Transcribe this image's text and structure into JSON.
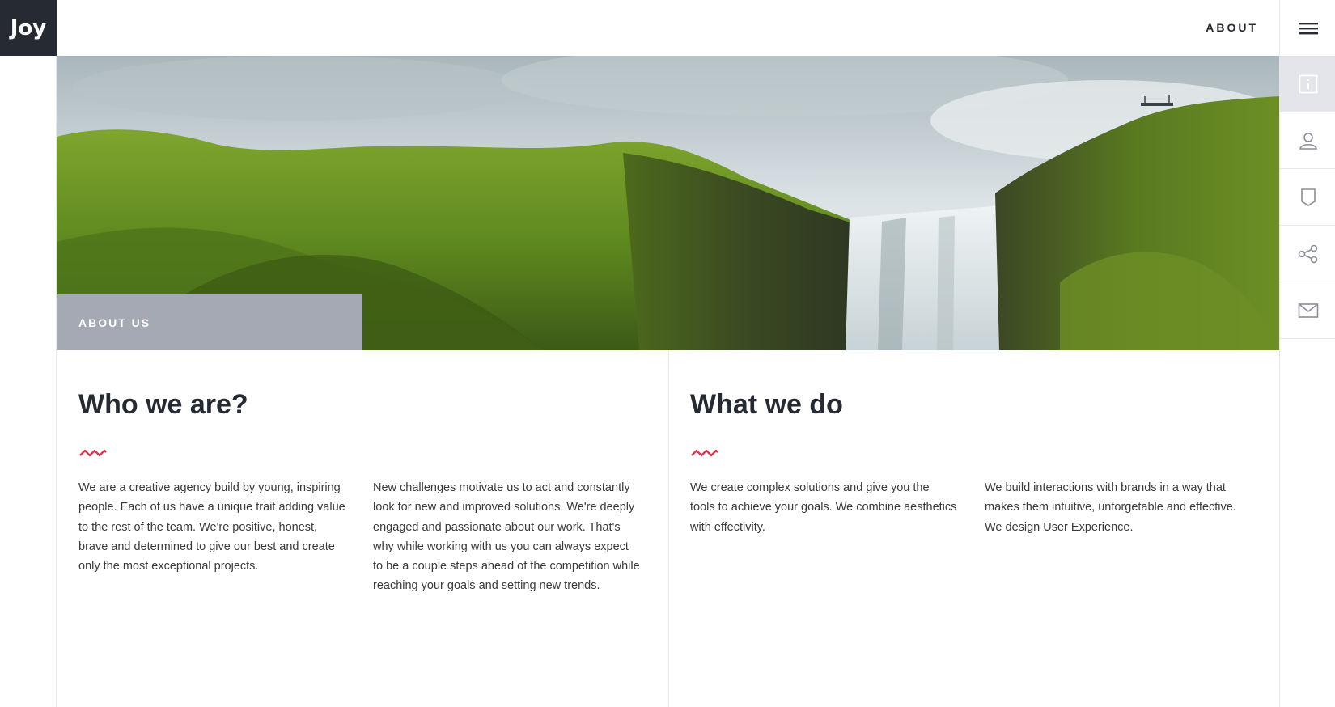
{
  "brand": {
    "logo_text": "Joy"
  },
  "header": {
    "nav_label": "ABOUT"
  },
  "sidebar": {
    "icons": [
      "info-icon",
      "user-icon",
      "bookmark-icon",
      "share-icon",
      "mail-icon"
    ],
    "active_index": 0
  },
  "hero": {
    "section_label": "ABOUT US"
  },
  "who": {
    "title": "Who we are?",
    "paragraph_1": "We are a creative agency build by young, inspiring people. Each of us have a unique trait adding value to the rest of the team. We're positive, honest, brave and determined to give our best and create only the most exceptional projects.",
    "paragraph_2": "New challenges motivate us to act and constantly look for new and improved solutions. We're deeply engaged and passionate about our work. That's why while working with us you can always expect to be a couple steps ahead of the competition while reaching your goals and setting new trends."
  },
  "what": {
    "title": "What we do",
    "paragraph_1": "We create complex solutions and give you the tools to achieve your goals. We combine aesthetics with effectivity.",
    "paragraph_2": "We build interactions with brands in a way that makes them intuitive, unforgetable and effective. We design User Experience."
  },
  "colors": {
    "dark": "#262a33",
    "accent": "#e0374f",
    "tab_gray": "#a5a9b3",
    "active_rail": "#e3e5ea"
  }
}
